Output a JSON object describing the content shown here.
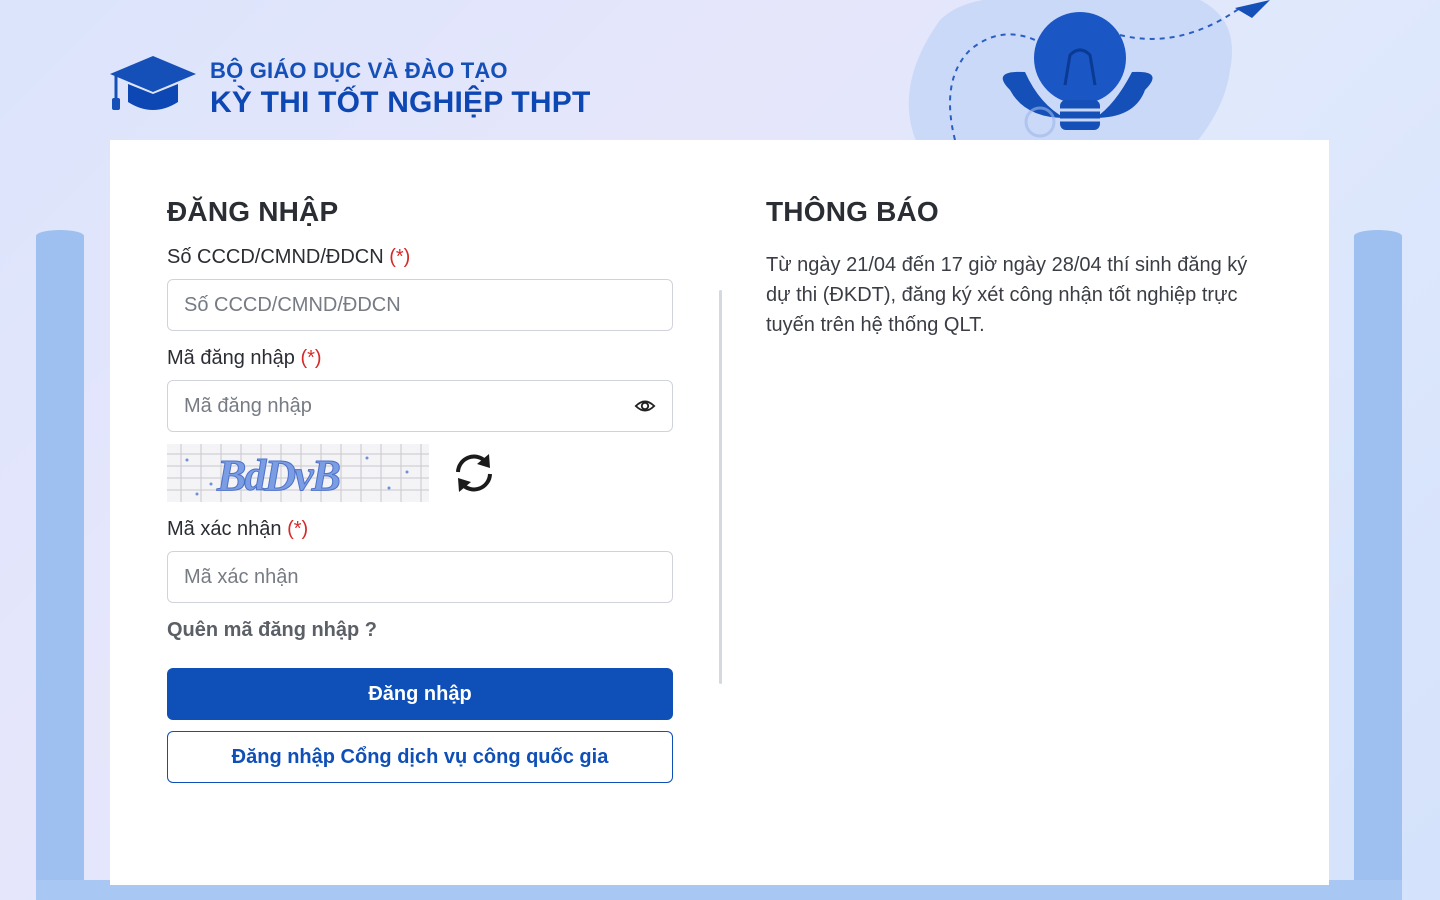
{
  "header": {
    "ministry": "BỘ GIÁO DỤC VÀ ĐÀO TẠO",
    "exam": "KỲ THI TỐT NGHIỆP THPT"
  },
  "login": {
    "title": "ĐĂNG NHẬP",
    "id_field": {
      "label": "Số CCCD/CMND/ĐDCN",
      "required_mark": "(*)",
      "placeholder": "Số CCCD/CMND/ĐDCN",
      "value": ""
    },
    "password_field": {
      "label": "Mã đăng nhập",
      "required_mark": "(*)",
      "placeholder": "Mã đăng nhập",
      "value": ""
    },
    "captcha_text": "BdDvB",
    "captcha_field": {
      "label": "Mã xác nhận",
      "required_mark": "(*)",
      "placeholder": "Mã xác nhận",
      "value": ""
    },
    "forgot_link": "Quên mã đăng nhập ?",
    "submit_button": "Đăng nhập",
    "national_portal_button": "Đăng nhập Cổng dịch vụ công quốc gia"
  },
  "notice": {
    "title": "THÔNG BÁO",
    "text": "Từ ngày 21/04 đến 17 giờ ngày 28/04 thí sinh đăng ký dự thi (ĐKDT), đăng ký xét công nhận tốt nghiệp trực tuyến trên hệ thống QLT."
  },
  "colors": {
    "primary": "#0e4fb8",
    "required": "#d62a2a",
    "book_edge": "#9dc0f1"
  },
  "icons": [
    "graduation-cap-icon",
    "lightbulb-icon",
    "paper-plane-icon",
    "eye-icon",
    "refresh-icon"
  ]
}
